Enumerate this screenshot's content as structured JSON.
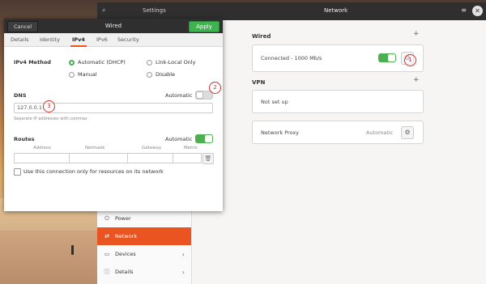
{
  "settings": {
    "title_left": "Settings",
    "title_center": "Network",
    "close_glyph": "✕",
    "sidebar": {
      "items": [
        {
          "label": "Power",
          "icon": "power-icon",
          "glyph": "⏻",
          "active": false,
          "chevron": false
        },
        {
          "label": "Network",
          "icon": "network-icon",
          "glyph": "⇄",
          "active": true,
          "chevron": false
        },
        {
          "label": "Devices",
          "icon": "devices-icon",
          "glyph": "▭",
          "active": false,
          "chevron": true
        },
        {
          "label": "Details",
          "icon": "details-icon",
          "glyph": "ⓘ",
          "active": false,
          "chevron": true
        }
      ]
    },
    "wired": {
      "title": "Wired",
      "add": "+",
      "status": "Connected - 1000 Mb/s",
      "toggle_on": true
    },
    "vpn": {
      "title": "VPN",
      "add": "+",
      "status": "Not set up"
    },
    "proxy": {
      "label": "Network Proxy",
      "value": "Automatic"
    }
  },
  "markers": {
    "m1": "1",
    "m2": "2",
    "m3": "3"
  },
  "dialog": {
    "cancel_label": "Cancel",
    "title": "Wired",
    "apply_label": "Apply",
    "tabs": [
      "Details",
      "Identity",
      "IPv4",
      "IPv6",
      "Security"
    ],
    "active_tab": "IPv4",
    "ipv4_method_label": "IPv4 Method",
    "methods": [
      {
        "label": "Automatic (DHCP)",
        "selected": true
      },
      {
        "label": "Link-Local Only",
        "selected": false
      },
      {
        "label": "Manual",
        "selected": false
      },
      {
        "label": "Disable",
        "selected": false
      }
    ],
    "dns": {
      "label": "DNS",
      "automatic_label": "Automatic",
      "automatic_on": false,
      "value": "127.0.0.1",
      "hint": "Separate IP addresses with commas"
    },
    "routes": {
      "label": "Routes",
      "automatic_label": "Automatic",
      "automatic_on": true,
      "columns": [
        "Address",
        "Netmask",
        "Gateway",
        "Metric"
      ]
    },
    "only_resources_label": "Use this connection only for resources on its network"
  },
  "colors": {
    "accent": "#e95420",
    "toggle_green": "#4caf50",
    "apply_green": "#3eb34f",
    "marker_red": "#d0312d"
  }
}
